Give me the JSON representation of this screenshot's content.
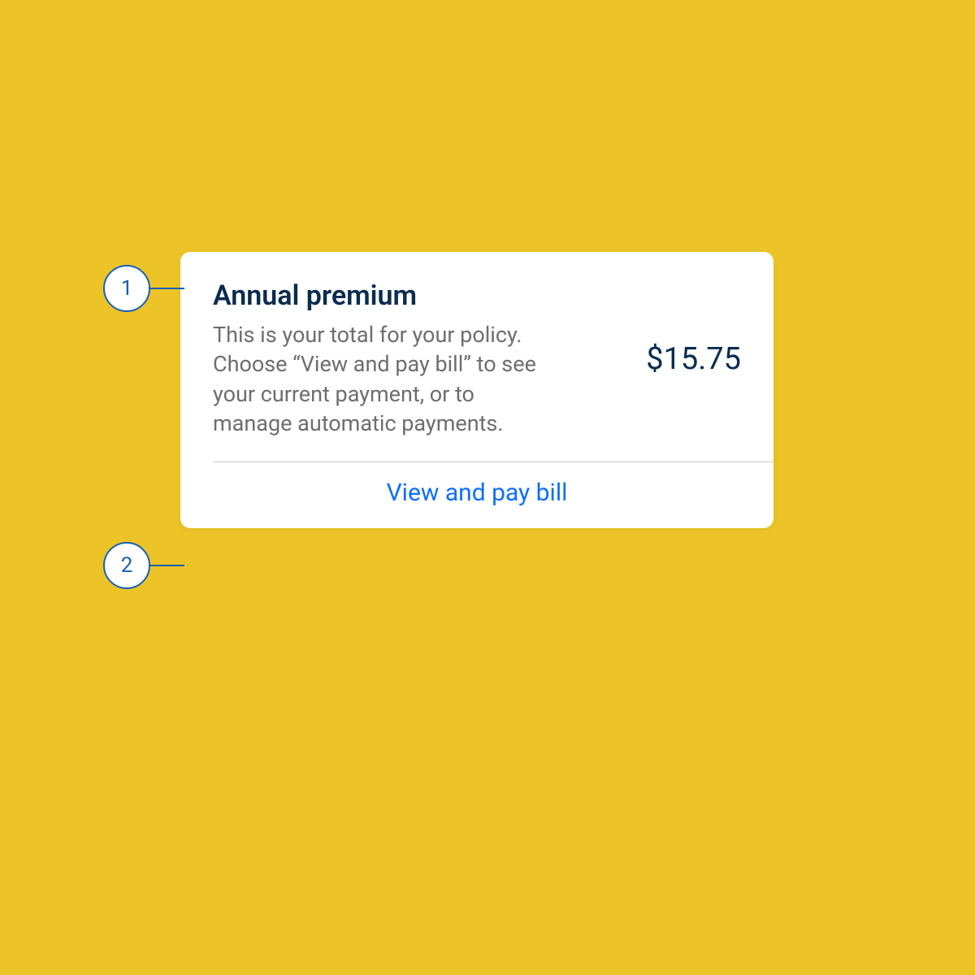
{
  "annotations": {
    "one": "1",
    "two": "2"
  },
  "card": {
    "title": "Annual premium",
    "description": "This is your total for your policy. Choose “View and pay bill” to see your current payment, or to manage automatic payments.",
    "amount": "$15.75",
    "action_label": "View and pay bill"
  }
}
